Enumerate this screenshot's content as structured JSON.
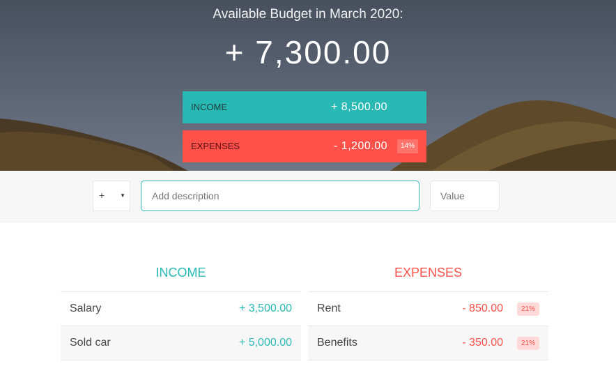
{
  "budget": {
    "title": "Available Budget in March 2020:",
    "value": "+ 7,300.00",
    "income": {
      "label": "Income",
      "value": "+ 8,500.00"
    },
    "expenses": {
      "label": "Expenses",
      "value": "- 1,200.00",
      "percentage": "14%"
    }
  },
  "add": {
    "type_selected": "+",
    "description_placeholder": "Add description",
    "value_placeholder": "Value"
  },
  "income": {
    "title": "Income",
    "items": [
      {
        "description": "Salary",
        "value": "+ 3,500.00"
      },
      {
        "description": "Sold car",
        "value": "+ 5,000.00"
      }
    ]
  },
  "expenses": {
    "title": "Expenses",
    "items": [
      {
        "description": "Rent",
        "value": "- 850.00",
        "percentage": "21%"
      },
      {
        "description": "Benefits",
        "value": "- 350.00",
        "percentage": "21%"
      }
    ]
  },
  "colors": {
    "income": "#28b9b5",
    "expenses": "#ff5049"
  }
}
